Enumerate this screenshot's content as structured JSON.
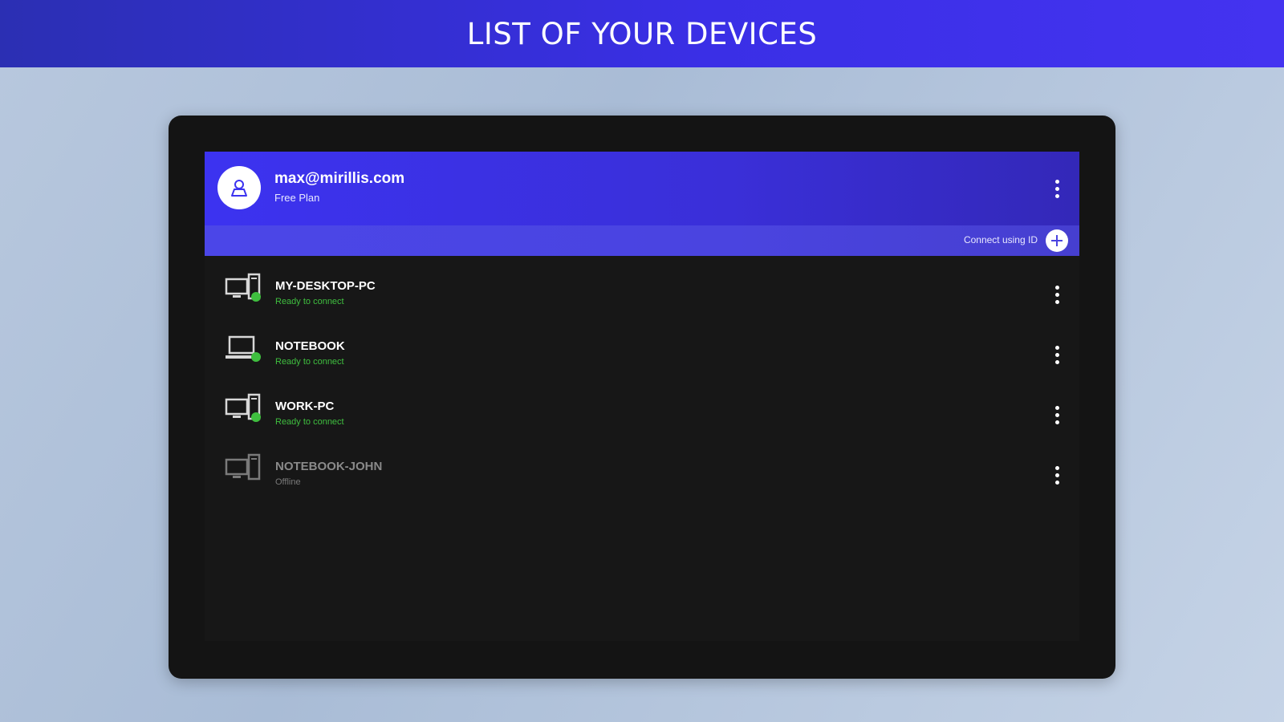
{
  "banner": {
    "title": "LIST OF YOUR DEVICES"
  },
  "account": {
    "email": "max@mirillis.com",
    "plan": "Free Plan",
    "connect_label": "Connect using ID"
  },
  "devices": [
    {
      "name": "MY-DESKTOP-PC",
      "status": "Ready to connect",
      "icon": "desktop-tower-icon",
      "online": true
    },
    {
      "name": "NOTEBOOK",
      "status": "Ready to connect",
      "icon": "laptop-icon",
      "online": true
    },
    {
      "name": "WORK-PC",
      "status": "Ready to connect",
      "icon": "desktop-tower-icon",
      "online": true
    },
    {
      "name": "NOTEBOOK-JOHN",
      "status": "Offline",
      "icon": "desktop-tower-icon",
      "online": false
    }
  ],
  "colors": {
    "accent": "#3c33f0",
    "online_status": "#3fbf3f",
    "offline_status": "#7a7a7a",
    "panel_background": "#171717"
  }
}
